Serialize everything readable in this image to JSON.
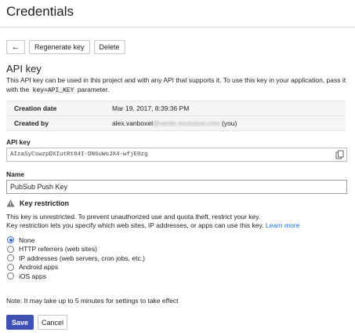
{
  "header": {
    "title": "Credentials"
  },
  "toolbar": {
    "back_glyph": "←",
    "regenerate_label": "Regenerate key",
    "delete_label": "Delete"
  },
  "api_key_section": {
    "title": "API key",
    "description_part1": "This API key can be used in this project and with any API that supports it. To use this key in your application, pass it with the ",
    "param_code": "key=API_KEY",
    "description_part2": " parameter."
  },
  "info": [
    {
      "label": "Creation date",
      "value": "Mar 19, 2017, 8:39:36 PM"
    },
    {
      "label": "Created by",
      "value_prefix": "alex.vanboxel",
      "value_blurred": "@vente-exclusive.com",
      "value_suffix": " (you)"
    }
  ],
  "api_key_field": {
    "label": "API key",
    "value": "AIzaSyCswzpDXIutRt84I-DN6uWoJX4-wfjE0zg",
    "copy_icon": "copy-icon"
  },
  "name_field": {
    "label": "Name",
    "value": "PubSub Push Key"
  },
  "key_restriction": {
    "title": "Key restriction",
    "icon": "warning-icon",
    "line1": "This key is unrestricted. To prevent unauthorized use and quota theft, restrict your key.",
    "line2": "Key restriction lets you specify which web sites, IP addresses, or apps can use this key. ",
    "learn_more": "Learn more",
    "options": [
      {
        "label": "None",
        "selected": true
      },
      {
        "label": "HTTP referrers (web sites)",
        "selected": false
      },
      {
        "label": "IP addresses (web servers, cron jobs, etc.)",
        "selected": false
      },
      {
        "label": "Android apps",
        "selected": false
      },
      {
        "label": "iOS apps",
        "selected": false
      }
    ]
  },
  "note": "Note: It may take up to 5 minutes for settings to take effect",
  "footer": {
    "save_label": "Save",
    "cancel_label": "Cancel"
  },
  "colors": {
    "primary": "#3f51b5",
    "link": "#1a73e8",
    "radio_selected": "#3367d6"
  }
}
